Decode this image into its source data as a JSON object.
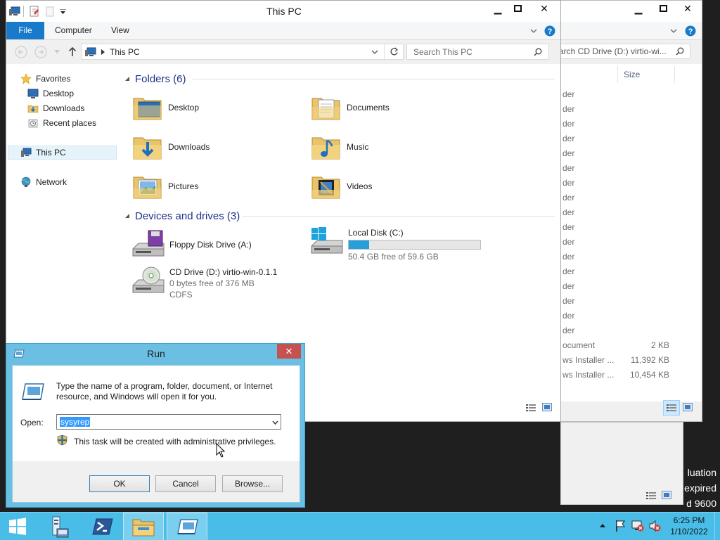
{
  "desktop": {
    "watermark_lines": [
      "luation",
      "expired",
      "d 9600"
    ]
  },
  "bg_window": {
    "search_placeholder": "arch CD Drive (D:) virtio-wi...",
    "size_header": "Size",
    "rows": [
      {
        "type": "der",
        "size": ""
      },
      {
        "type": "der",
        "size": ""
      },
      {
        "type": "der",
        "size": ""
      },
      {
        "type": "der",
        "size": ""
      },
      {
        "type": "der",
        "size": ""
      },
      {
        "type": "der",
        "size": ""
      },
      {
        "type": "der",
        "size": ""
      },
      {
        "type": "der",
        "size": ""
      },
      {
        "type": "der",
        "size": ""
      },
      {
        "type": "der",
        "size": ""
      },
      {
        "type": "der",
        "size": ""
      },
      {
        "type": "der",
        "size": ""
      },
      {
        "type": "der",
        "size": ""
      },
      {
        "type": "der",
        "size": ""
      },
      {
        "type": "der",
        "size": ""
      },
      {
        "type": "der",
        "size": ""
      },
      {
        "type": "der",
        "size": ""
      },
      {
        "type": "ocument",
        "size": "2 KB"
      },
      {
        "type": "ws Installer ...",
        "size": "11,392 KB"
      },
      {
        "type": "ws Installer ...",
        "size": "10,454 KB"
      }
    ]
  },
  "explorer": {
    "title": "This PC",
    "tabs": [
      "File",
      "Computer",
      "View"
    ],
    "address": "This PC",
    "search_placeholder": "Search This PC",
    "nav": {
      "favorites": "Favorites",
      "favorites_items": [
        "Desktop",
        "Downloads",
        "Recent places"
      ],
      "this_pc": "This PC",
      "network": "Network"
    },
    "folders_header": "Folders (6)",
    "folders": [
      {
        "name": "Desktop",
        "icon": "desktop-folder-icon"
      },
      {
        "name": "Documents",
        "icon": "documents-folder-icon"
      },
      {
        "name": "Downloads",
        "icon": "downloads-folder-icon"
      },
      {
        "name": "Music",
        "icon": "music-folder-icon"
      },
      {
        "name": "Pictures",
        "icon": "pictures-folder-icon"
      },
      {
        "name": "Videos",
        "icon": "videos-folder-icon"
      }
    ],
    "drives_header": "Devices and drives (3)",
    "drives": {
      "floppy": {
        "name": "Floppy Disk Drive (A:)"
      },
      "local": {
        "name": "Local Disk (C:)",
        "free": "50.4 GB free of 59.6 GB",
        "used_fraction": 0.154
      },
      "cd": {
        "name": "CD Drive (D:) virtio-win-0.1.1",
        "free": "0 bytes free of 376 MB",
        "fs": "CDFS"
      }
    }
  },
  "run_dialog": {
    "title": "Run",
    "description": "Type the name of a program, folder, document, or Internet resource, and Windows will open it for you.",
    "open_label": "Open:",
    "open_value": "sysyrep",
    "admin_note": "This task will be created with administrative privileges.",
    "ok": "OK",
    "cancel": "Cancel",
    "browse": "Browse..."
  },
  "taskbar": {
    "time": "6:25 PM",
    "date": "1/10/2022"
  },
  "colors": {
    "accent": "#1979ca",
    "taskbar": "#49bde8",
    "run_frame": "#6bbfe2",
    "close_red": "#c75050",
    "drive_bar": "#26a0da"
  }
}
